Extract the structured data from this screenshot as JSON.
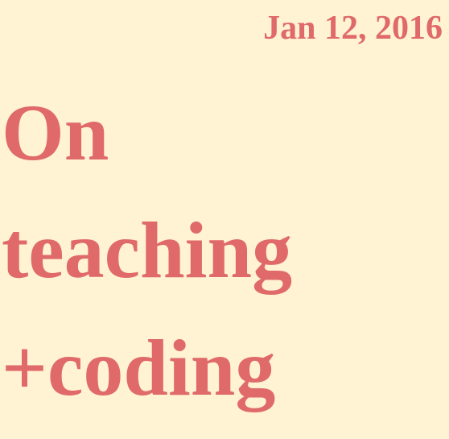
{
  "post": {
    "date": "Jan 12, 2016",
    "title_lines": [
      "On",
      "teaching",
      "+coding"
    ]
  },
  "colors": {
    "background": "#fff3d3",
    "text": "#e06a6a"
  }
}
